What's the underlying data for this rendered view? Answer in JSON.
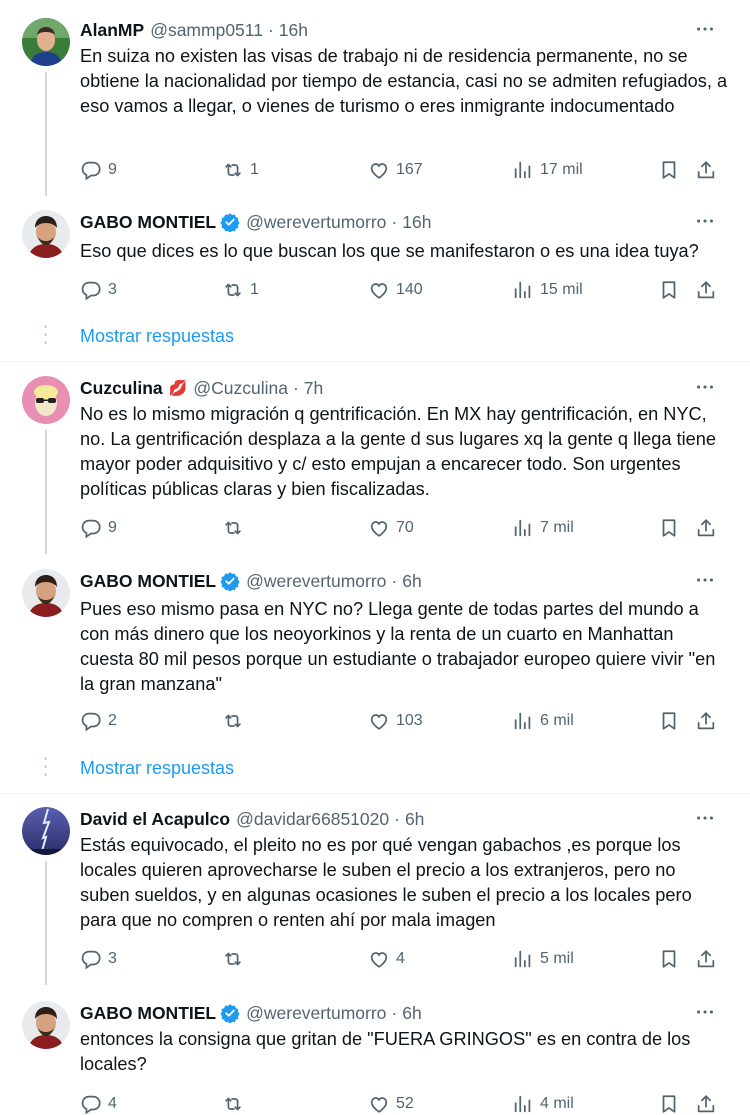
{
  "tweets": [
    {
      "name": "AlanMP",
      "handle": "@sammp0511",
      "time": "16h",
      "text": "En suiza no existen las visas de trabajo ni de residencia permanente, no se obtiene la nacionalidad por tiempo de estancia, casi no se admiten refugiados, a eso vamos a llegar, o vienes de turismo o eres inmigrante indocumentado",
      "replies": "9",
      "retweets": "1",
      "likes": "167",
      "views": "17 mil"
    },
    {
      "name": "GABO MONTIEL",
      "handle": "@werevertumorro",
      "time": "16h",
      "text": "Eso que dices es lo que buscan los que se manifestaron o es una idea tuya?",
      "replies": "3",
      "retweets": "1",
      "likes": "140",
      "views": "15 mil"
    },
    {
      "name": "Cuzculina",
      "emoji": "💋",
      "handle": "@Cuzculina",
      "time": "7h",
      "text": "No es lo mismo migración q gentrificación. En MX hay gentrificación, en NYC, no. La gentrificación desplaza a la gente d sus lugares xq la gente q llega tiene mayor poder adquisitivo y c/ esto empujan a encarecer todo. Son urgentes políticas públicas claras y bien fiscalizadas.",
      "replies": "9",
      "retweets": "",
      "likes": "70",
      "views": "7 mil"
    },
    {
      "name": "GABO MONTIEL",
      "handle": "@werevertumorro",
      "time": "6h",
      "text": "Pues eso mismo pasa en NYC no? Llega gente de todas partes del mundo a con más dinero que los neoyorkinos y la renta de un cuarto en Manhattan cuesta 80 mil pesos porque un estudiante o trabajador europeo quiere vivir \"en la gran manzana\"",
      "replies": "2",
      "retweets": "",
      "likes": "103",
      "views": "6 mil"
    },
    {
      "name": "David el Acapulco",
      "handle": "@davidar66851020",
      "time": "6h",
      "text": "Estás equivocado, el pleito no es por qué vengan gabachos ,es porque los locales quieren aprovecharse le suben el precio a los extranjeros, pero no suben sueldos, y en algunas ocasiones le suben el precio a los locales pero para que no compren o renten ahí por mala imagen",
      "replies": "3",
      "retweets": "",
      "likes": "4",
      "views": "5 mil"
    },
    {
      "name": "GABO MONTIEL",
      "handle": "@werevertumorro",
      "time": "6h",
      "text": "entonces la consigna que gritan de \"FUERA GRINGOS\" es en contra de los locales?",
      "replies": "4",
      "retweets": "",
      "likes": "52",
      "views": "4 mil"
    }
  ],
  "show_replies_label": "Mostrar respuestas",
  "colors": {
    "accent": "#1d9bf0",
    "secondary": "#536471",
    "text": "#0f1419",
    "verified": "#1d9bf0"
  }
}
